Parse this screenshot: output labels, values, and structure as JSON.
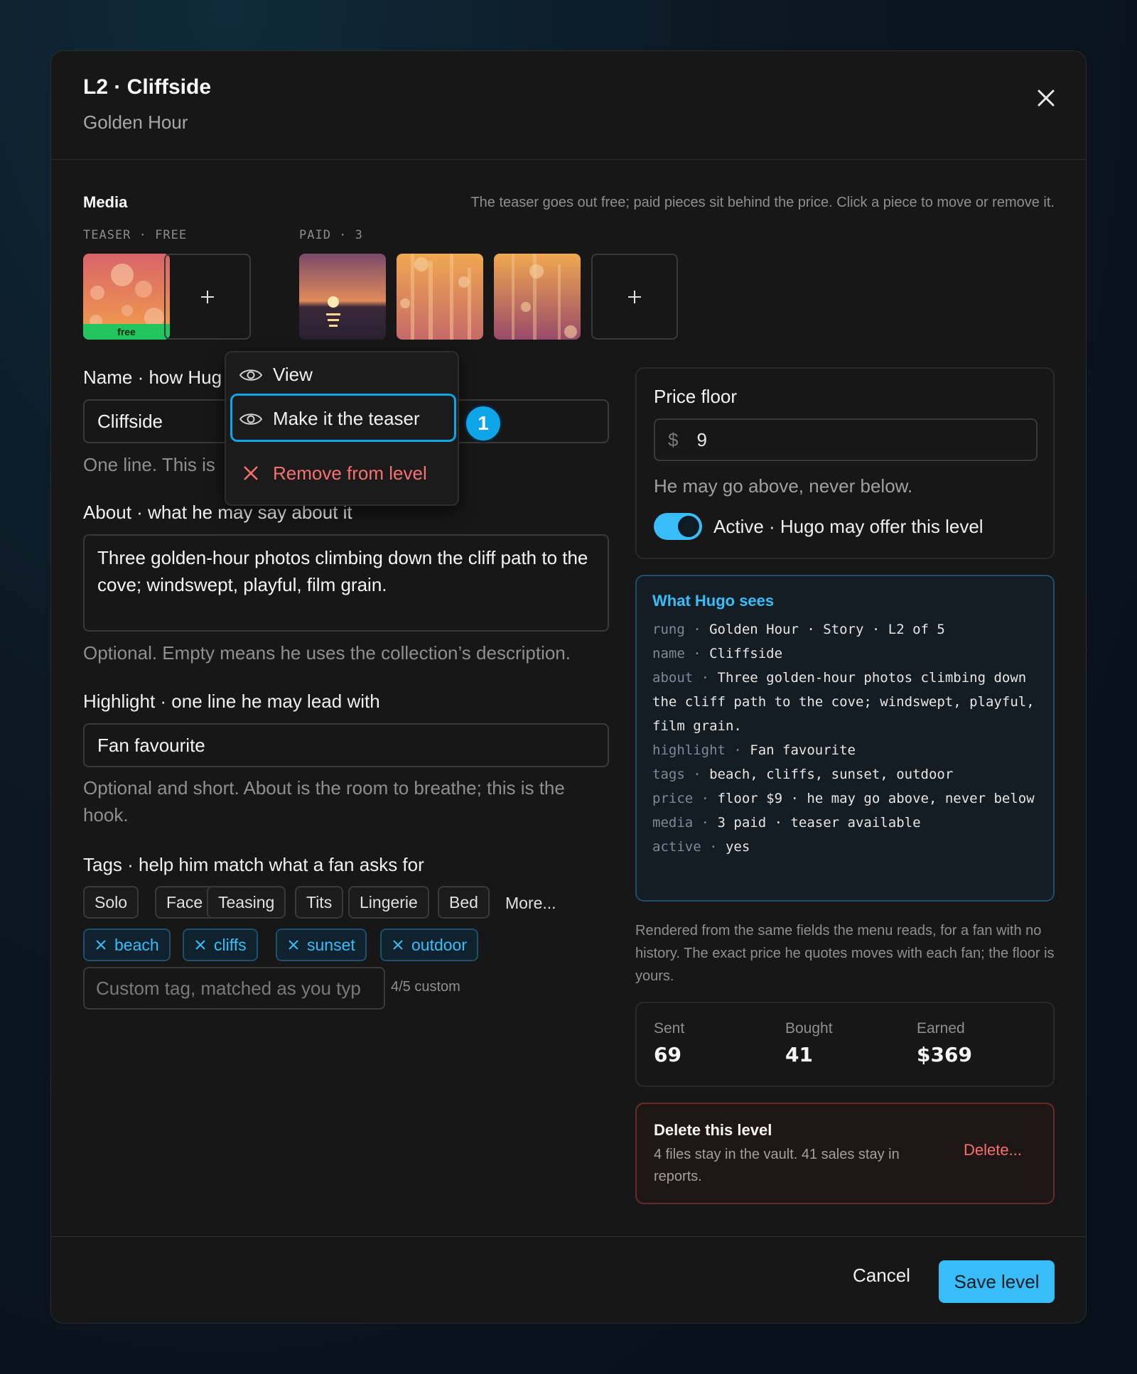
{
  "header": {
    "title": "L2 · Cliffside",
    "subtitle": "Golden Hour"
  },
  "media": {
    "label": "Media",
    "help": "The teaser goes out free; paid pieces sit behind the price. Click a piece to move or remove it.",
    "teaser_label": "TEASER · FREE",
    "paid_label": "PAID · 3",
    "free_badge": "free"
  },
  "name_field": {
    "label": "Name · how Hug",
    "value": "Cliffside",
    "hint": "One line. This is "
  },
  "context_menu": {
    "view": "View",
    "make_teaser": "Make it the teaser",
    "remove": "Remove from level",
    "step": "1"
  },
  "about_field": {
    "label": "About · what he may say about it",
    "value": "Three golden-hour photos climbing down the cliff path to the cove; windswept, playful, film grain.",
    "hint": "Optional. Empty means he uses the collection’s description."
  },
  "highlight_field": {
    "label": "Highlight · one line he may lead with",
    "value": "Fan favourite",
    "hint": "Optional and short. About is the room to breathe; this is the hook."
  },
  "tags": {
    "label": "Tags · help him match what a fan asks for",
    "suggested": [
      "Solo",
      "Face",
      "Teasing",
      "Tits",
      "Lingerie",
      "Bed"
    ],
    "more": "More...",
    "selected": [
      "beach",
      "cliffs",
      "sunset",
      "outdoor"
    ],
    "custom_placeholder": "Custom tag, matched as you typ",
    "custom_count": "4/5 custom"
  },
  "price": {
    "title": "Price floor",
    "currency": "$",
    "value": "9",
    "hint": "He may go above, never below.",
    "active_label": "Active · Hugo may offer this level"
  },
  "sees": {
    "title": "What Hugo sees",
    "rows": [
      {
        "key": "rung",
        "value": "Golden Hour · Story · L2 of 5"
      },
      {
        "key": "name",
        "value": "Cliffside"
      },
      {
        "key": "about",
        "value": "Three golden-hour photos climbing down the cliff path to the cove; windswept, playful, film grain."
      },
      {
        "key": "highlight",
        "value": "Fan favourite"
      },
      {
        "key": "tags",
        "value": "beach, cliffs, sunset, outdoor"
      },
      {
        "key": "price",
        "value": "floor $9 · he may go above, never below"
      },
      {
        "key": "media",
        "value": "3 paid · teaser available"
      },
      {
        "key": "active",
        "value": "yes"
      }
    ],
    "note": "Rendered from the same fields the menu reads, for a fan with no history. The exact price he quotes moves with each fan; the floor is yours."
  },
  "stats": [
    {
      "label": "Sent",
      "value": "69"
    },
    {
      "label": "Bought",
      "value": "41"
    },
    {
      "label": "Earned",
      "value": "$369"
    }
  ],
  "danger": {
    "title": "Delete this level",
    "text": "4 files stay in the vault. 41 sales stay in reports.",
    "button": "Delete..."
  },
  "footer": {
    "cancel": "Cancel",
    "save": "Save level"
  },
  "colors": {
    "accent": "#38bdf8",
    "free": "#22c55e",
    "danger": "#f87171"
  }
}
